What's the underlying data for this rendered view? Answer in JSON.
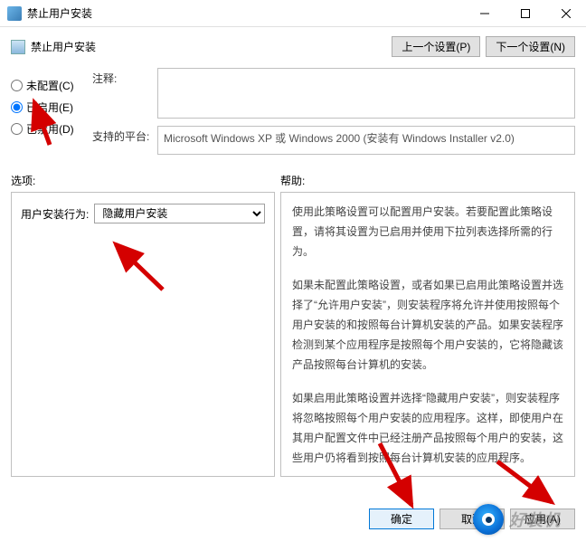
{
  "window": {
    "title": "禁止用户安装"
  },
  "header": {
    "policy_title": "禁止用户安装",
    "prev_btn": "上一个设置(P)",
    "next_btn": "下一个设置(N)"
  },
  "radios": {
    "not_configured": "未配置(C)",
    "enabled": "已启用(E)",
    "disabled": "已禁用(D)",
    "selected": "enabled"
  },
  "fields": {
    "comment_label": "注释:",
    "platform_label": "支持的平台:",
    "platform_value": "Microsoft Windows XP 或 Windows 2000 (安装有 Windows Installer v2.0)"
  },
  "mid": {
    "options_label": "选项:",
    "help_label": "帮助:"
  },
  "options": {
    "behavior_label": "用户安装行为:",
    "behavior_value": "隐藏用户安装"
  },
  "help": {
    "p1": "使用此策略设置可以配置用户安装。若要配置此策略设置，请将其设置为已启用并使用下拉列表选择所需的行为。",
    "p2": "如果未配置此策略设置，或者如果已启用此策略设置并选择了“允许用户安装”，则安装程序将允许并使用按照每个用户安装的和按照每台计算机安装的产品。如果安装程序检测到某个应用程序是按照每个用户安装的，它将隐藏该产品按照每台计算机的安装。",
    "p3": "如果启用此策略设置并选择“隐藏用户安装”，则安装程序将忽略按照每个用户安装的应用程序。这样，即使用户在其用户配置文件中已经注册产品按照每个用户的安装，这些用户仍将看到按照每台计算机安装的应用程序。"
  },
  "footer": {
    "ok": "确定",
    "cancel": "取消",
    "apply": "应用(A)"
  },
  "watermark": {
    "text": "好装机"
  }
}
